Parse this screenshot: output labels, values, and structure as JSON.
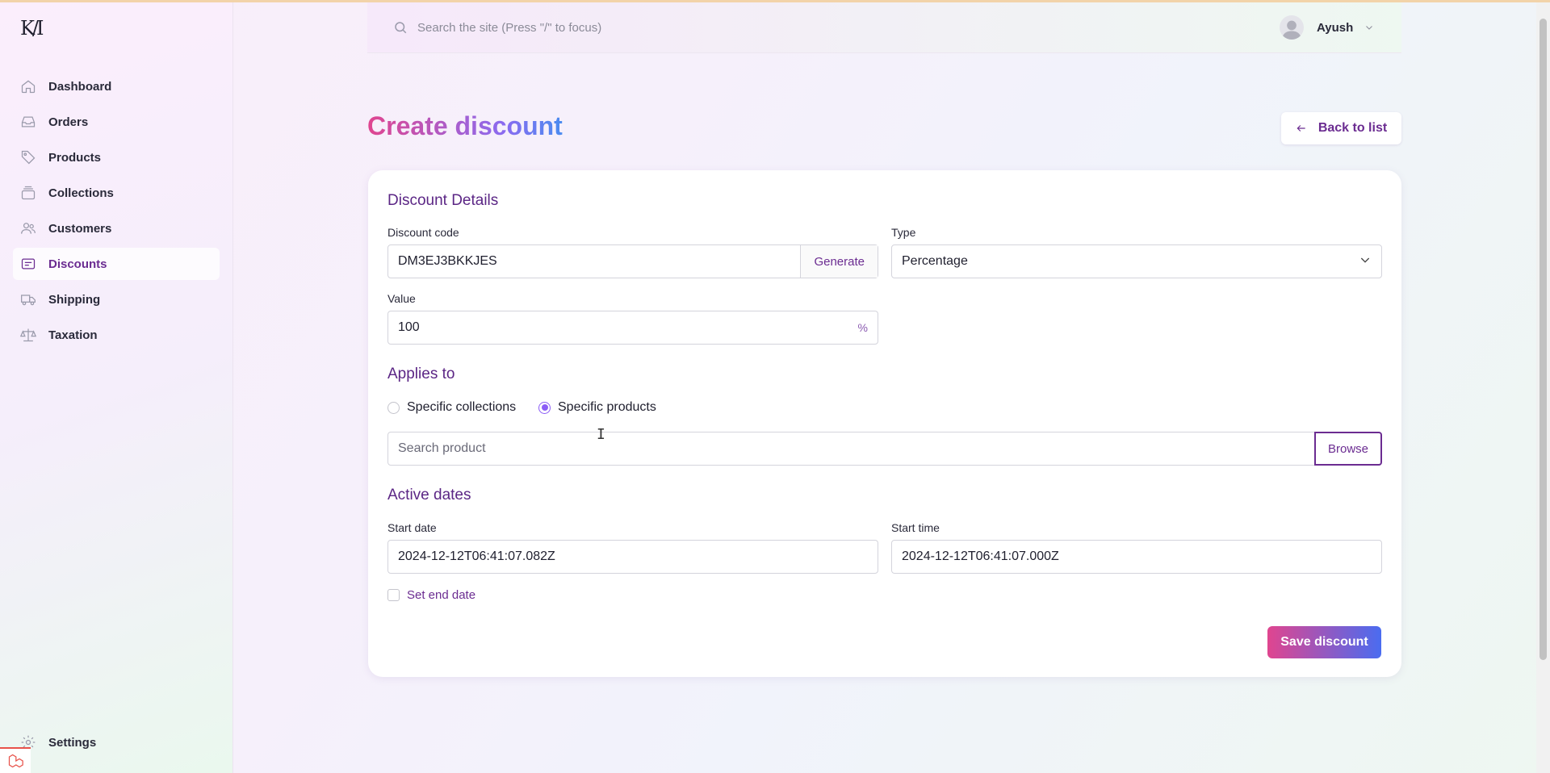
{
  "app": {
    "logo": "KA"
  },
  "sidebar": {
    "items": [
      {
        "label": "Dashboard",
        "icon": "home-icon"
      },
      {
        "label": "Orders",
        "icon": "inbox-icon"
      },
      {
        "label": "Products",
        "icon": "tag-icon"
      },
      {
        "label": "Collections",
        "icon": "stack-icon"
      },
      {
        "label": "Customers",
        "icon": "users-icon"
      },
      {
        "label": "Discounts",
        "icon": "receipt-icon",
        "active": true
      },
      {
        "label": "Shipping",
        "icon": "truck-icon"
      },
      {
        "label": "Taxation",
        "icon": "scale-icon"
      }
    ],
    "settings_label": "Settings"
  },
  "header": {
    "search_placeholder": "Search the site (Press \"/\" to focus)",
    "user_name": "Ayush"
  },
  "page": {
    "title": "Create discount",
    "back_label": "Back to list"
  },
  "form": {
    "details_title": "Discount Details",
    "code_label": "Discount code",
    "code_value": "DM3EJ3BKKJES",
    "generate_label": "Generate",
    "type_label": "Type",
    "type_value": "Percentage",
    "value_label": "Value",
    "value_value": "100",
    "value_suffix": "%",
    "applies_title": "Applies to",
    "radio_collections": "Specific collections",
    "radio_products": "Specific products",
    "product_search_placeholder": "Search product",
    "browse_label": "Browse",
    "dates_title": "Active dates",
    "start_date_label": "Start date",
    "start_date_value": "2024-12-12T06:41:07.082Z",
    "start_time_label": "Start time",
    "start_time_value": "2024-12-12T06:41:07.000Z",
    "end_date_label": "Set end date",
    "save_label": "Save discount"
  },
  "colors": {
    "accent": "#6b2c91",
    "radio_checked": "#8b5cf6",
    "gradient_start": "#e0458f",
    "gradient_end": "#4a6cf0"
  }
}
